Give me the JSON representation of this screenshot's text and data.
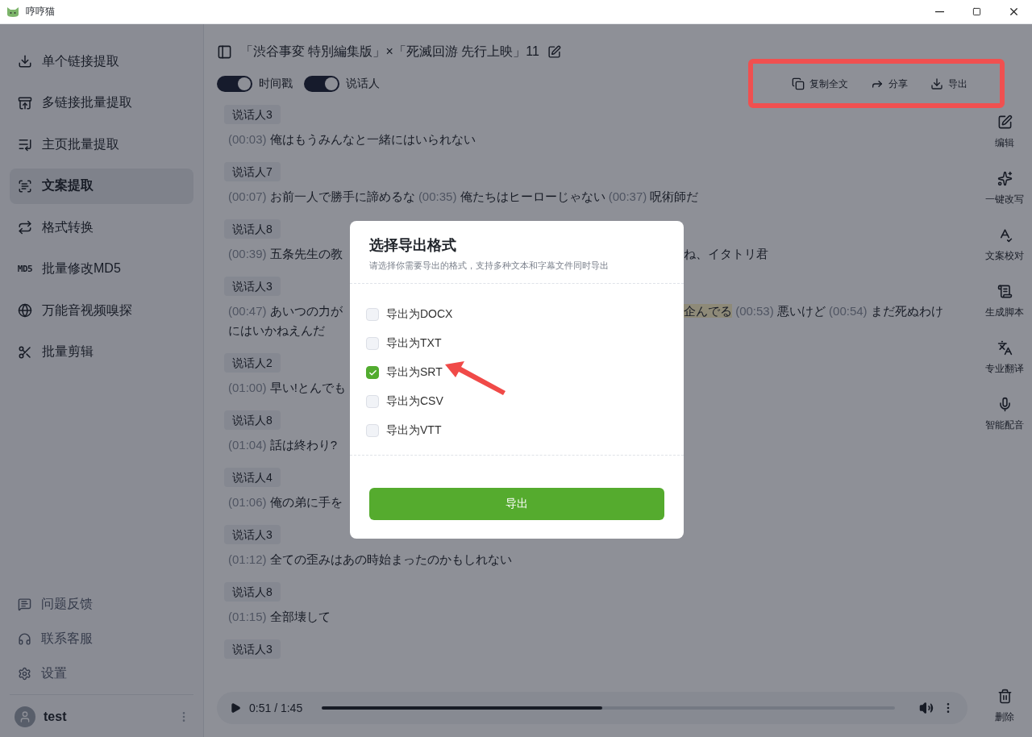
{
  "window": {
    "title": "哼哼猫"
  },
  "sidebar": {
    "items": [
      {
        "label": "单个链接提取",
        "selected": false
      },
      {
        "label": "多链接批量提取",
        "selected": false
      },
      {
        "label": "主页批量提取",
        "selected": false
      },
      {
        "label": "文案提取",
        "selected": true
      },
      {
        "label": "格式转换",
        "selected": false
      },
      {
        "label": "批量修改MD5",
        "selected": false,
        "icon_text": "MD5"
      },
      {
        "label": "万能音视频嗅探",
        "selected": false
      },
      {
        "label": "批量剪辑",
        "selected": false
      }
    ],
    "footer_items": [
      {
        "label": "问题反馈"
      },
      {
        "label": "联系客服"
      },
      {
        "label": "设置"
      }
    ],
    "user": {
      "name": "test"
    }
  },
  "document": {
    "title": "「渋谷事変 特別編集版」×「死滅回游 先行上映」11",
    "toggles": [
      {
        "label": "时间戳",
        "on": true
      },
      {
        "label": "说话人",
        "on": true
      }
    ],
    "actions": [
      {
        "label": "复制全文"
      },
      {
        "label": "分享"
      },
      {
        "label": "导出"
      }
    ]
  },
  "transcript": [
    {
      "speaker": "说话人3",
      "rows": [
        {
          "left": [
            {
              "time": "(00:03)",
              "text": "俺はもうみんなと一緒にはいられない",
              "highlighted": false
            }
          ]
        }
      ]
    },
    {
      "speaker": "说话人7",
      "rows": [
        {
          "left": [
            {
              "time": "(00:07)",
              "text": "お前一人で勝手に諦めるな",
              "highlighted": false
            },
            {
              "time": "(00:35)",
              "text": "俺たちはヒーローじゃない",
              "highlighted": false
            },
            {
              "time": "(00:37)",
              "text": "呪術師だ",
              "highlighted": false
            }
          ]
        }
      ]
    },
    {
      "speaker": "说话人8",
      "rows": [
        {
          "left": [
            {
              "time": "(00:39)",
              "text": "五条先生の教",
              "highlighted": false
            }
          ],
          "right": [
            {
              "text": "ね、イタトリ君",
              "highlighted": false
            }
          ]
        }
      ]
    },
    {
      "speaker": "说话人3",
      "rows": [
        {
          "left": [
            {
              "time": "(00:47)",
              "text": "あいつの力が",
              "highlighted": false
            }
          ],
          "right": [
            {
              "text": "企んでる",
              "highlighted": true
            },
            {
              "time": "(00:53)",
              "text": "悪いけど",
              "highlighted": false
            },
            {
              "time": "(00:54)",
              "text": "まだ死ぬわけ",
              "highlighted": false
            }
          ]
        },
        {
          "left": [
            {
              "text": "にはいかねえんだ",
              "highlighted": false
            }
          ]
        }
      ]
    },
    {
      "speaker": "说话人2",
      "rows": [
        {
          "left": [
            {
              "time": "(01:00)",
              "text": "早い!とんでも",
              "highlighted": false
            }
          ]
        }
      ]
    },
    {
      "speaker": "说话人8",
      "rows": [
        {
          "left": [
            {
              "time": "(01:04)",
              "text": "話は終わり?",
              "highlighted": false
            }
          ]
        }
      ]
    },
    {
      "speaker": "说话人4",
      "rows": [
        {
          "left": [
            {
              "time": "(01:06)",
              "text": "俺の弟に手を",
              "highlighted": false
            }
          ]
        }
      ]
    },
    {
      "speaker": "说话人3",
      "rows": [
        {
          "left": [
            {
              "time": "(01:12)",
              "text": "全ての歪みはあの時始まったのかもしれない",
              "highlighted": false
            }
          ]
        }
      ]
    },
    {
      "speaker": "说话人8",
      "rows": [
        {
          "left": [
            {
              "time": "(01:15)",
              "text": "全部壊して",
              "highlighted": false
            }
          ]
        }
      ]
    },
    {
      "speaker": "说话人3"
    }
  ],
  "player": {
    "time": "0:51 / 1:45",
    "level": 0.49
  },
  "tools": [
    {
      "label": "编辑"
    },
    {
      "label": "一键改写"
    },
    {
      "label": "文案校对"
    },
    {
      "label": "生成脚本"
    },
    {
      "label": "专业翻译"
    },
    {
      "label": "智能配音"
    }
  ],
  "delete_tool": {
    "label": "删除"
  },
  "dialog": {
    "title": "选择导出格式",
    "subtitle": "请选择你需要导出的格式，支持多种文本和字幕文件同时导出",
    "options": [
      {
        "label": "导出为DOCX",
        "checked": false
      },
      {
        "label": "导出为TXT",
        "checked": false
      },
      {
        "label": "导出为SRT",
        "checked": true
      },
      {
        "label": "导出为CSV",
        "checked": false
      },
      {
        "label": "导出为VTT",
        "checked": false
      }
    ],
    "button": "导出"
  }
}
